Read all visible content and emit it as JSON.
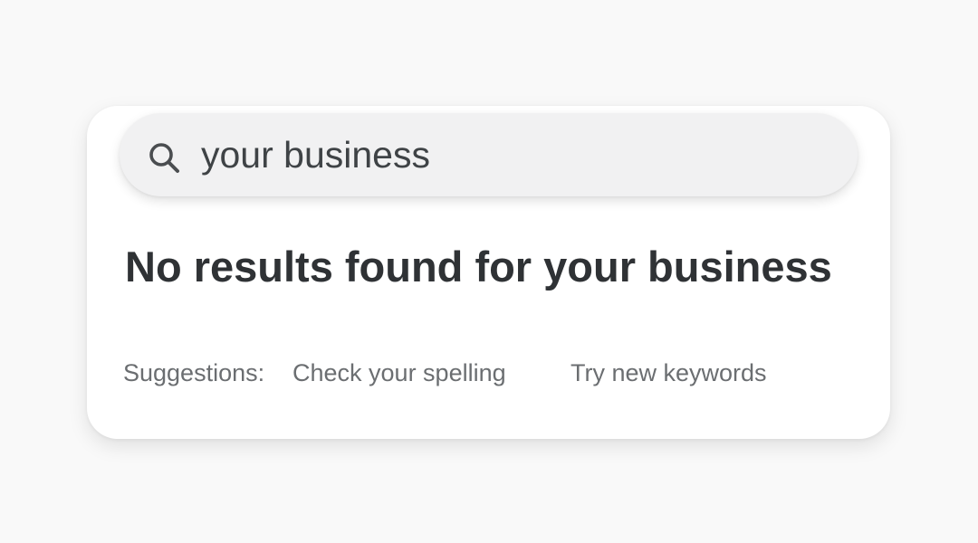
{
  "search": {
    "value": "your business",
    "icon": "search-icon"
  },
  "results": {
    "headline": "No results found for your business"
  },
  "suggestions": {
    "label": "Suggestions:",
    "items": [
      "Check your spelling",
      "Try new keywords"
    ]
  },
  "colors": {
    "background": "#f9f9f9",
    "card": "#ffffff",
    "search_bar": "#f1f1f2",
    "headline_text": "#2f3235",
    "muted_text": "#6b6e71"
  }
}
